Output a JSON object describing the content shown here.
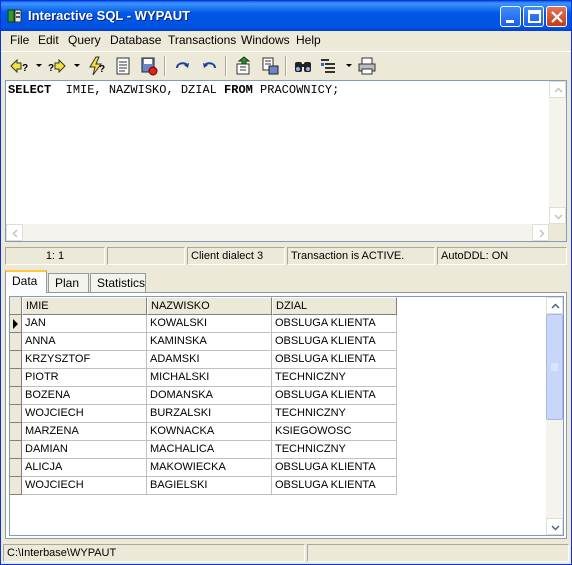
{
  "window": {
    "title": "Interactive SQL - WYPAUT",
    "title_bar_color": "#0058e6"
  },
  "menu": [
    "File",
    "Edit",
    "Query",
    "Database",
    "Transactions",
    "Windows",
    "Help"
  ],
  "toolbar": {
    "prev_label": "?",
    "next_label": "?",
    "execute_label": "?",
    "icons": [
      "prev-query-icon",
      "next-query-icon",
      "execute-query-icon",
      "prepare-icon",
      "save-icon",
      "commit-icon",
      "rollback-icon",
      "load-script-icon",
      "save-script-icon",
      "find-icon",
      "options-icon",
      "print-icon"
    ]
  },
  "editor": {
    "tokens": [
      {
        "text": "SELECT",
        "kw": true
      },
      {
        "text": "  IMIE, NAZWISKO, DZIAL ",
        "kw": false
      },
      {
        "text": "FROM",
        "kw": true
      },
      {
        "text": " PRACOWNICY;",
        "kw": false
      }
    ]
  },
  "status": {
    "position": "1:  1",
    "dialect": "Client dialect 3",
    "transaction": "Transaction is ACTIVE.",
    "autoddl": "AutoDDL: ON"
  },
  "tabs": [
    "Data",
    "Plan",
    "Statistics"
  ],
  "active_tab": "Data",
  "grid": {
    "columns": [
      "IMIE",
      "NAZWISKO",
      "DZIAL"
    ],
    "rows": [
      [
        "JAN",
        "KOWALSKI",
        "OBSLUGA KLIENTA"
      ],
      [
        "ANNA",
        "KAMINSKA",
        "OBSLUGA KLIENTA"
      ],
      [
        "KRZYSZTOF",
        "ADAMSKI",
        "OBSLUGA KLIENTA"
      ],
      [
        "PIOTR",
        "MICHALSKI",
        "TECHNICZNY"
      ],
      [
        "BOZENA",
        "DOMANSKA",
        "OBSLUGA KLIENTA"
      ],
      [
        "WOJCIECH",
        "BURZALSKI",
        "TECHNICZNY"
      ],
      [
        "MARZENA",
        "KOWNACKA",
        "KSIEGOWOSC"
      ],
      [
        "DAMIAN",
        "MACHALICA",
        "TECHNICZNY"
      ],
      [
        "ALICJA",
        "MAKOWIECKA",
        "OBSLUGA KLIENTA"
      ],
      [
        "WOJCIECH",
        "BAGIELSKI",
        "OBSLUGA KLIENTA"
      ]
    ],
    "current_row": 0
  },
  "footer": {
    "path": "C:\\Interbase\\WYPAUT"
  }
}
